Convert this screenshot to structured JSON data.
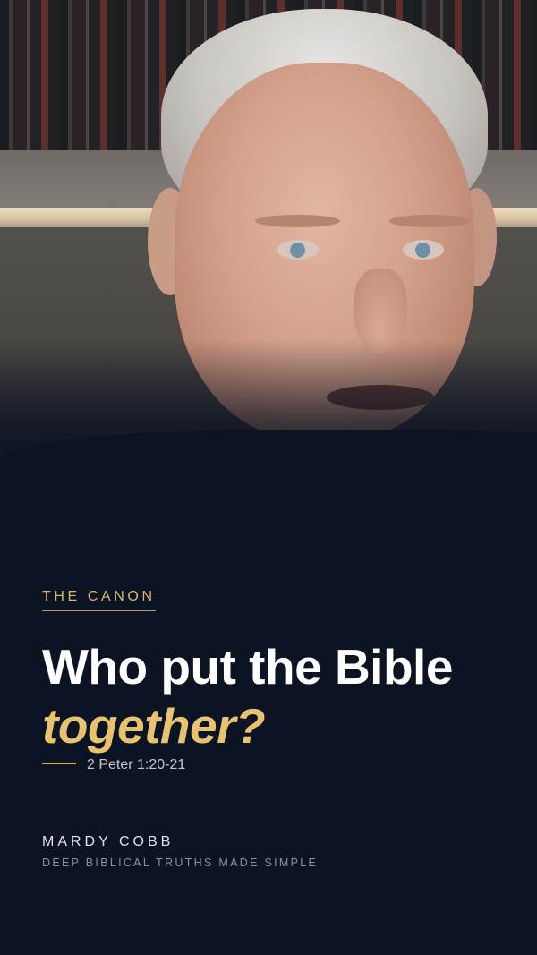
{
  "card": {
    "eyebrow": "THE CANON",
    "headline": {
      "line1": "Who put the Bible",
      "line2": "together?"
    },
    "reference": "2 Peter 1:20-21",
    "author": "MARDY COBB",
    "tagline": "DEEP BIBLICAL TRUTHS MADE SIMPLE"
  },
  "colors": {
    "background": "#0c1322",
    "accent_gold": "#e6c271",
    "headline_white": "#ffffff",
    "muted_text": "#8a91a0"
  }
}
